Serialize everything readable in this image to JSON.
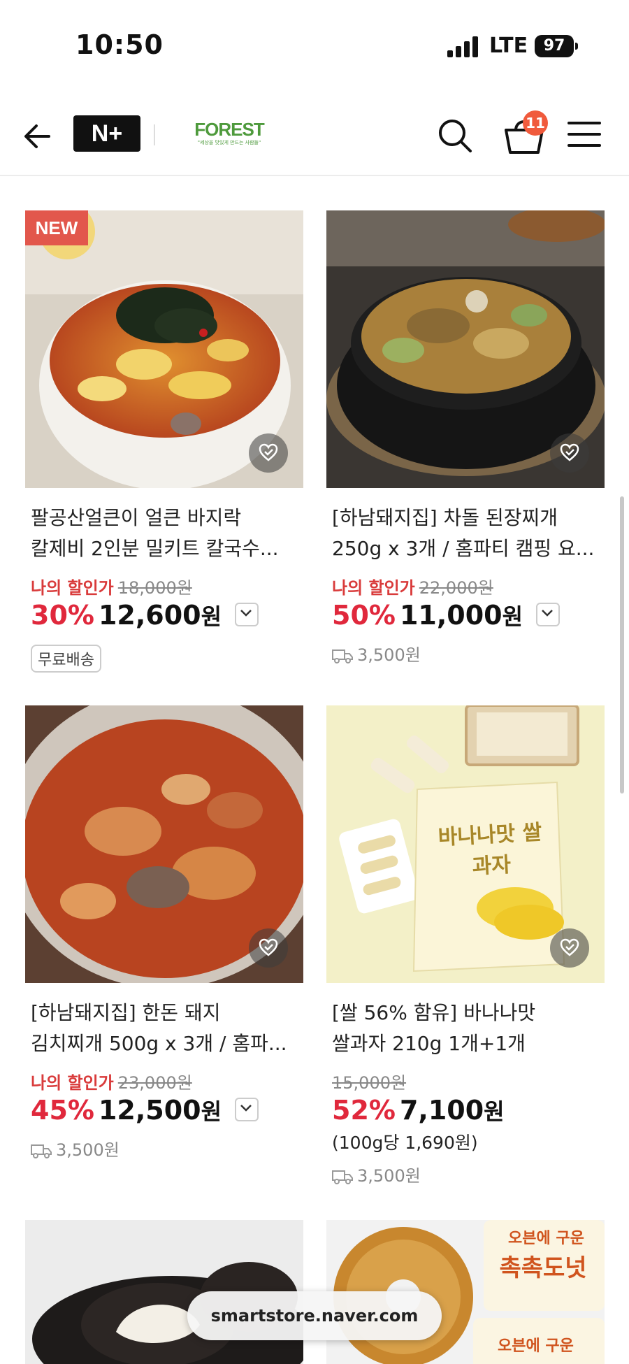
{
  "status_bar": {
    "time": "10:50",
    "network": "LTE",
    "battery": "97"
  },
  "header": {
    "brand_badge": "N+",
    "store_logo": "FOREST",
    "store_tagline": "\"세상을 맛있게 만드는 사람들\"",
    "cart_count": "11",
    "icons": [
      "back-arrow-icon",
      "search-icon",
      "cart-icon",
      "menu-icon"
    ]
  },
  "products": [
    {
      "badge": "NEW",
      "title_line1": "팔공산얼큰이 얼큰 바지락",
      "title_line2": "칼제비 2인분 밀키트 칼국수...",
      "discount_label": "나의 할인가",
      "original_price": "18,000원",
      "discount_pct": "30%",
      "price": "12,600",
      "currency": "원",
      "free_shipping_tag": "무료배송"
    },
    {
      "title_line1": "[하남돼지집] 차돌 된장찌개",
      "title_line2": "250g x 3개 / 홈파티 캠핑 요...",
      "discount_label": "나의 할인가",
      "original_price": "22,000원",
      "discount_pct": "50%",
      "price": "11,000",
      "currency": "원",
      "shipping_fee": "3,500원"
    },
    {
      "title_line1": "[하남돼지집] 한돈 돼지",
      "title_line2": "김치찌개 500g x 3개 / 홈파...",
      "discount_label": "나의 할인가",
      "original_price": "23,000원",
      "discount_pct": "45%",
      "price": "12,500",
      "currency": "원",
      "shipping_fee": "3,500원"
    },
    {
      "title_line1": "[쌀 56% 함유] 바나나맛",
      "title_line2": "쌀과자 210g 1개+1개",
      "original_price": "15,000원",
      "discount_pct": "52%",
      "price": "7,100",
      "currency": "원",
      "unit_price": "(100g당 1,690원)",
      "shipping_fee": "3,500원",
      "package_text": "바나나맛 쌀과자"
    }
  ],
  "bottom_packaging_text": "오븐에 구운",
  "url_bar": {
    "url": "smartstore.naver.com"
  }
}
